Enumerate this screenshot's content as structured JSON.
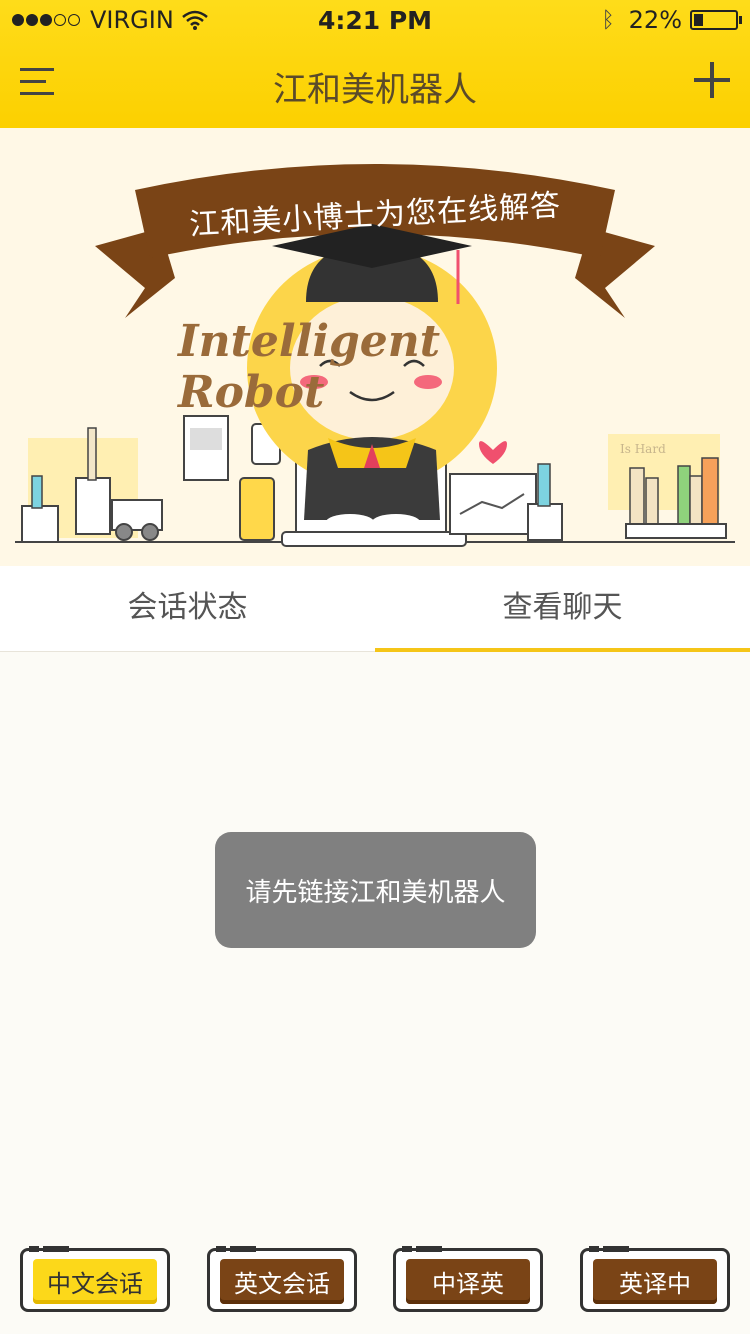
{
  "status_bar": {
    "carrier": "VIRGIN",
    "signal_strength": 3,
    "signal_max": 5,
    "time": "4:21 PM",
    "battery": "22%",
    "battery_level": 0.22
  },
  "nav": {
    "title": "江和美机器人"
  },
  "banner": {
    "ribbon_text": "江和美小博士为您在线解答",
    "brand_text": "Intelligent Robot",
    "book_label": "Is Hard"
  },
  "tabs": [
    {
      "label": "会话状态",
      "active": false
    },
    {
      "label": "查看聊天",
      "active": true
    }
  ],
  "toast": {
    "message": "请先链接江和美机器人"
  },
  "bottom_buttons": [
    {
      "label": "中文会话",
      "active": true
    },
    {
      "label": "英文会话",
      "active": false
    },
    {
      "label": "中译英",
      "active": false
    },
    {
      "label": "英译中",
      "active": false
    }
  ],
  "colors": {
    "accent": "#fcd000",
    "brown": "#7a4416",
    "toast_bg": "#808080"
  }
}
